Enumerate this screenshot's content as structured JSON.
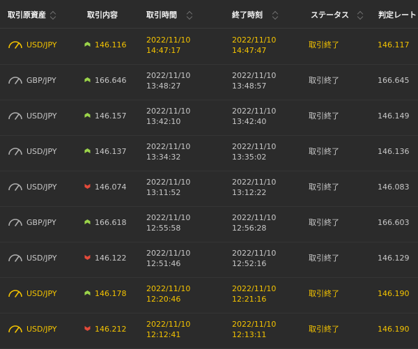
{
  "colors": {
    "background": "#2b2b2b",
    "win": "#f5c400",
    "text": "#c8c8c8",
    "up": "#9bd44a",
    "down": "#e34a3a"
  },
  "header": {
    "asset": "取引原資産",
    "entry": "取引内容",
    "start_time": "取引時間",
    "end_time": "終了時刻",
    "status": "ステータス",
    "judge_rate": "判定レート"
  },
  "rows": [
    {
      "asset": "USD/JPY",
      "direction": "up",
      "entry": "146.116",
      "start_date": "2022/11/10",
      "start_time": "14:47:17",
      "end_date": "2022/11/10",
      "end_time": "14:47:47",
      "status": "取引終了",
      "judge": "146.117",
      "win": true
    },
    {
      "asset": "GBP/JPY",
      "direction": "up",
      "entry": "166.646",
      "start_date": "2022/11/10",
      "start_time": "13:48:27",
      "end_date": "2022/11/10",
      "end_time": "13:48:57",
      "status": "取引終了",
      "judge": "166.645",
      "win": false
    },
    {
      "asset": "USD/JPY",
      "direction": "up",
      "entry": "146.157",
      "start_date": "2022/11/10",
      "start_time": "13:42:10",
      "end_date": "2022/11/10",
      "end_time": "13:42:40",
      "status": "取引終了",
      "judge": "146.149",
      "win": false
    },
    {
      "asset": "USD/JPY",
      "direction": "up",
      "entry": "146.137",
      "start_date": "2022/11/10",
      "start_time": "13:34:32",
      "end_date": "2022/11/10",
      "end_time": "13:35:02",
      "status": "取引終了",
      "judge": "146.136",
      "win": false
    },
    {
      "asset": "USD/JPY",
      "direction": "down",
      "entry": "146.074",
      "start_date": "2022/11/10",
      "start_time": "13:11:52",
      "end_date": "2022/11/10",
      "end_time": "13:12:22",
      "status": "取引終了",
      "judge": "146.083",
      "win": false
    },
    {
      "asset": "GBP/JPY",
      "direction": "up",
      "entry": "166.618",
      "start_date": "2022/11/10",
      "start_time": "12:55:58",
      "end_date": "2022/11/10",
      "end_time": "12:56:28",
      "status": "取引終了",
      "judge": "166.603",
      "win": false
    },
    {
      "asset": "USD/JPY",
      "direction": "down",
      "entry": "146.122",
      "start_date": "2022/11/10",
      "start_time": "12:51:46",
      "end_date": "2022/11/10",
      "end_time": "12:52:16",
      "status": "取引終了",
      "judge": "146.129",
      "win": false
    },
    {
      "asset": "USD/JPY",
      "direction": "up",
      "entry": "146.178",
      "start_date": "2022/11/10",
      "start_time": "12:20:46",
      "end_date": "2022/11/10",
      "end_time": "12:21:16",
      "status": "取引終了",
      "judge": "146.190",
      "win": true
    },
    {
      "asset": "USD/JPY",
      "direction": "down",
      "entry": "146.212",
      "start_date": "2022/11/10",
      "start_time": "12:12:41",
      "end_date": "2022/11/10",
      "end_time": "12:13:11",
      "status": "取引終了",
      "judge": "146.190",
      "win": true
    }
  ]
}
